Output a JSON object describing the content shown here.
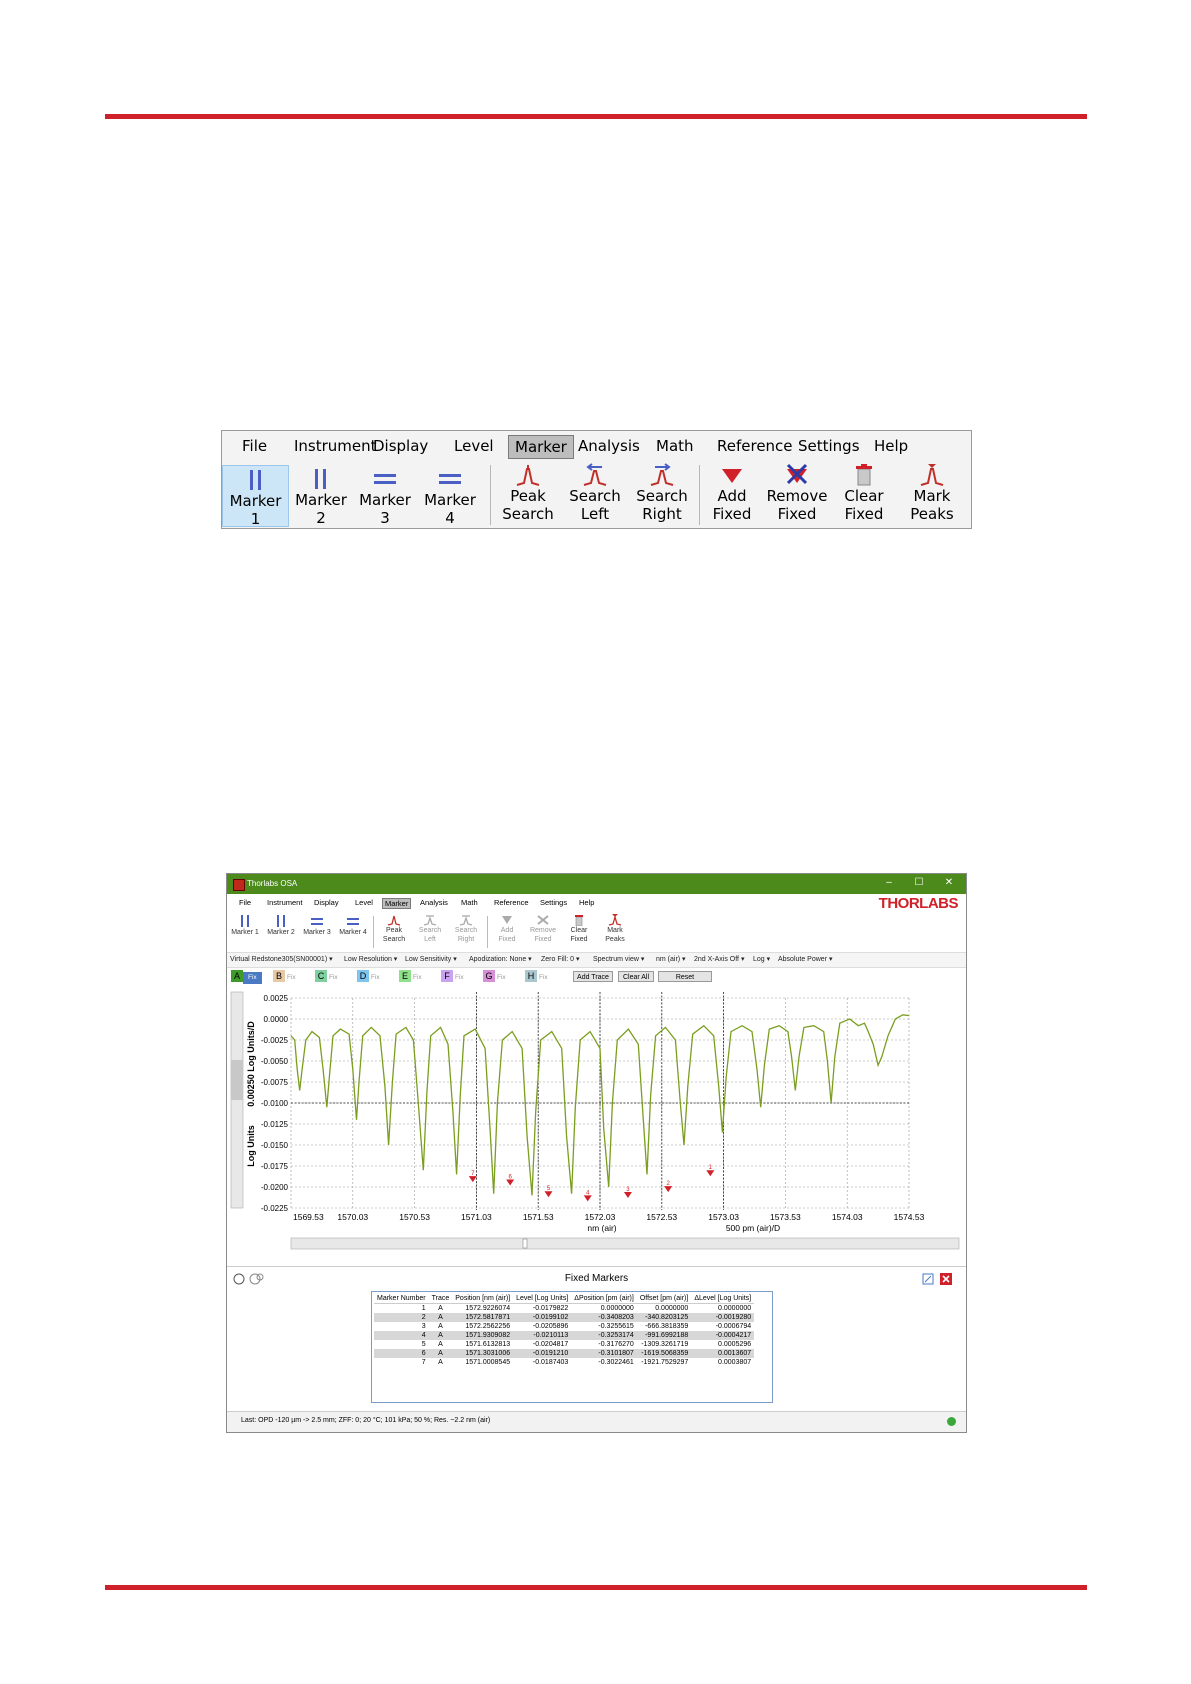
{
  "ribbon": {
    "menu": [
      "File",
      "Instrument",
      "Display",
      "Level",
      "Marker",
      "Analysis",
      "Math",
      "Reference",
      "Settings",
      "Help"
    ],
    "active_menu": "Marker",
    "buttons": [
      {
        "label1": "Marker 1",
        "label2": "",
        "icon": "marker-bars-icon"
      },
      {
        "label1": "Marker 2",
        "label2": "",
        "icon": "marker-bars-icon"
      },
      {
        "label1": "Marker 3",
        "label2": "",
        "icon": "marker-lines-icon"
      },
      {
        "label1": "Marker 4",
        "label2": "",
        "icon": "marker-lines-icon"
      },
      {
        "label1": "Peak",
        "label2": "Search",
        "icon": "peak-search-icon"
      },
      {
        "label1": "Search",
        "label2": "Left",
        "icon": "search-left-icon"
      },
      {
        "label1": "Search",
        "label2": "Right",
        "icon": "search-right-icon"
      },
      {
        "label1": "Add",
        "label2": "Fixed",
        "icon": "add-fixed-icon"
      },
      {
        "label1": "Remove",
        "label2": "Fixed",
        "icon": "remove-fixed-icon"
      },
      {
        "label1": "Clear",
        "label2": "Fixed",
        "icon": "clear-fixed-icon"
      },
      {
        "label1": "Mark",
        "label2": "Peaks",
        "icon": "mark-peaks-icon"
      }
    ]
  },
  "app": {
    "title": "Thorlabs OSA",
    "window_controls": [
      "–",
      "☐",
      "✕"
    ],
    "logo": "THORLABS",
    "menu": [
      "File",
      "Instrument",
      "Display",
      "Level",
      "Marker",
      "Analysis",
      "Math",
      "Reference",
      "Settings",
      "Help"
    ],
    "small_buttons": [
      {
        "l1": "Marker 1",
        "l2": ""
      },
      {
        "l1": "Marker 2",
        "l2": ""
      },
      {
        "l1": "Marker 3",
        "l2": ""
      },
      {
        "l1": "Marker 4",
        "l2": ""
      },
      {
        "l1": "Peak",
        "l2": "Search"
      },
      {
        "l1": "Search",
        "l2": "Left"
      },
      {
        "l1": "Search",
        "l2": "Right"
      },
      {
        "l1": "Add",
        "l2": "Fixed"
      },
      {
        "l1": "Remove",
        "l2": "Fixed"
      },
      {
        "l1": "Clear",
        "l2": "Fixed"
      },
      {
        "l1": "Mark",
        "l2": "Peaks"
      }
    ],
    "options": [
      "Virtual Redstone305(SN00001) ▾",
      "Low Resolution ▾",
      "Low Sensitivity ▾",
      "Apodization: None ▾",
      "Zero Fill: 0 ▾",
      "Spectrum view ▾",
      "nm (air) ▾",
      "2nd X-Axis Off ▾",
      "Log ▾",
      "Absolute Power ▾"
    ],
    "traces": [
      {
        "letter": "A",
        "fix": "Fix",
        "color": "#3f9a2a"
      },
      {
        "letter": "B",
        "fix": "Fix",
        "color": "#e7c9a6"
      },
      {
        "letter": "C",
        "fix": "Fix",
        "color": "#7fd0a0"
      },
      {
        "letter": "D",
        "fix": "Fix",
        "color": "#7ec4ef"
      },
      {
        "letter": "E",
        "fix": "Fix",
        "color": "#8ee08a"
      },
      {
        "letter": "F",
        "fix": "Fix",
        "color": "#c9a3ef"
      },
      {
        "letter": "G",
        "fix": "Fix",
        "color": "#d78fd6"
      },
      {
        "letter": "H",
        "fix": "Fix",
        "color": "#aac7cf"
      }
    ],
    "trace_buttons": [
      "Add Trace",
      "Clear All",
      "Reset"
    ],
    "fixed_markers_title": "Fixed Markers",
    "status": "Last: OPD -120 µm -> 2.5 mm; ZFF: 0; 20 °C; 101 kPa; 50 %; Res. ~2.2 nm (air)"
  },
  "chart_data": {
    "type": "line",
    "ylabel_top": "0.00250 Log Units/D",
    "ylabel_bottom": "Log Units",
    "xlabel": "nm (air)",
    "xlabel_right": "500 pm (air)/D",
    "x_ticks": [
      "1569.53",
      "1570.03",
      "1570.53",
      "1571.03",
      "1571.53",
      "1572.03",
      "1572.53",
      "1573.03",
      "1573.53",
      "1574.03",
      "1574.53"
    ],
    "y_ticks": [
      "0.0025",
      "0.0000",
      "-0.0025",
      "-0.0050",
      "-0.0075",
      "-0.0100",
      "-0.0125",
      "-0.0150",
      "-0.0175",
      "-0.0200",
      "-0.0225"
    ],
    "xlim": [
      1569.53,
      1574.53
    ],
    "ylim": [
      -0.0225,
      0.0025
    ],
    "series": [
      {
        "color": "#7a9e1e",
        "points": [
          [
            1569.53,
            -0.002
          ],
          [
            1569.56,
            -0.0025
          ],
          [
            1569.58,
            -0.006
          ],
          [
            1569.6,
            -0.0085
          ],
          [
            1569.62,
            -0.006
          ],
          [
            1569.65,
            -0.0025
          ],
          [
            1569.7,
            -0.0015
          ],
          [
            1569.76,
            -0.0022
          ],
          [
            1569.79,
            -0.006
          ],
          [
            1569.82,
            -0.0105
          ],
          [
            1569.84,
            -0.007
          ],
          [
            1569.87,
            -0.002
          ],
          [
            1569.93,
            -0.0012
          ],
          [
            1570.0,
            -0.0018
          ],
          [
            1570.03,
            -0.006
          ],
          [
            1570.06,
            -0.012
          ],
          [
            1570.08,
            -0.0075
          ],
          [
            1570.11,
            -0.002
          ],
          [
            1570.18,
            -0.001
          ],
          [
            1570.25,
            -0.002
          ],
          [
            1570.29,
            -0.008
          ],
          [
            1570.32,
            -0.015
          ],
          [
            1570.35,
            -0.0075
          ],
          [
            1570.38,
            -0.0018
          ],
          [
            1570.46,
            -0.001
          ],
          [
            1570.52,
            -0.0025
          ],
          [
            1570.56,
            -0.01
          ],
          [
            1570.6,
            -0.018
          ],
          [
            1570.63,
            -0.0085
          ],
          [
            1570.66,
            -0.002
          ],
          [
            1570.74,
            -0.001
          ],
          [
            1570.8,
            -0.003
          ],
          [
            1570.84,
            -0.011
          ],
          [
            1570.87,
            -0.0185
          ],
          [
            1570.9,
            -0.009
          ],
          [
            1570.93,
            -0.002
          ],
          [
            1571.02,
            -0.0012
          ],
          [
            1571.1,
            -0.0035
          ],
          [
            1571.14,
            -0.013
          ],
          [
            1571.17,
            -0.0208
          ],
          [
            1571.2,
            -0.01
          ],
          [
            1571.24,
            -0.0025
          ],
          [
            1571.32,
            -0.0015
          ],
          [
            1571.4,
            -0.0035
          ],
          [
            1571.44,
            -0.014
          ],
          [
            1571.48,
            -0.021
          ],
          [
            1571.51,
            -0.011
          ],
          [
            1571.55,
            -0.0025
          ],
          [
            1571.64,
            -0.0015
          ],
          [
            1571.72,
            -0.0035
          ],
          [
            1571.76,
            -0.014
          ],
          [
            1571.8,
            -0.0208
          ],
          [
            1571.83,
            -0.0105
          ],
          [
            1571.87,
            -0.0025
          ],
          [
            1571.95,
            -0.0015
          ],
          [
            1572.03,
            -0.0035
          ],
          [
            1572.06,
            -0.013
          ],
          [
            1572.1,
            -0.02
          ],
          [
            1572.13,
            -0.01
          ],
          [
            1572.17,
            -0.0025
          ],
          [
            1572.26,
            -0.0012
          ],
          [
            1572.34,
            -0.003
          ],
          [
            1572.38,
            -0.012
          ],
          [
            1572.41,
            -0.0185
          ],
          [
            1572.44,
            -0.009
          ],
          [
            1572.48,
            -0.002
          ],
          [
            1572.56,
            -0.001
          ],
          [
            1572.64,
            -0.0025
          ],
          [
            1572.68,
            -0.01
          ],
          [
            1572.71,
            -0.015
          ],
          [
            1572.74,
            -0.008
          ],
          [
            1572.78,
            -0.0018
          ],
          [
            1572.87,
            -0.0008
          ],
          [
            1572.95,
            -0.002
          ],
          [
            1572.99,
            -0.008
          ],
          [
            1573.02,
            -0.0135
          ],
          [
            1573.05,
            -0.007
          ],
          [
            1573.09,
            -0.0015
          ],
          [
            1573.18,
            -0.0008
          ],
          [
            1573.26,
            -0.0015
          ],
          [
            1573.3,
            -0.006
          ],
          [
            1573.33,
            -0.0105
          ],
          [
            1573.36,
            -0.0055
          ],
          [
            1573.4,
            -0.0012
          ],
          [
            1573.48,
            -0.0008
          ],
          [
            1573.55,
            -0.0015
          ],
          [
            1573.58,
            -0.0045
          ],
          [
            1573.61,
            -0.0085
          ],
          [
            1573.64,
            -0.0045
          ],
          [
            1573.68,
            -0.001
          ],
          [
            1573.76,
            -0.0008
          ],
          [
            1573.84,
            -0.0015
          ],
          [
            1573.87,
            -0.005
          ],
          [
            1573.9,
            -0.01
          ],
          [
            1573.93,
            -0.0045
          ],
          [
            1573.97,
            -0.0005
          ],
          [
            1574.05,
            0.0
          ],
          [
            1574.12,
            -0.0008
          ],
          [
            1574.17,
            -0.0005
          ],
          [
            1574.2,
            -0.0015
          ],
          [
            1574.24,
            -0.003
          ],
          [
            1574.28,
            -0.0055
          ],
          [
            1574.31,
            -0.0045
          ],
          [
            1574.36,
            -0.002
          ],
          [
            1574.42,
            0.0
          ],
          [
            1574.48,
            0.0005
          ],
          [
            1574.53,
            0.0004
          ]
        ]
      }
    ],
    "marker_lines": [
      1571.03,
      1571.53,
      1572.03,
      1572.53,
      1573.03
    ],
    "fixed_markers": [
      {
        "x": 1571.0009,
        "y": -0.0187,
        "label": "7"
      },
      {
        "x": 1571.3031,
        "y": -0.0191,
        "label": "6"
      },
      {
        "x": 1571.6133,
        "y": -0.0205,
        "label": "5"
      },
      {
        "x": 1571.9309,
        "y": -0.021,
        "label": "4"
      },
      {
        "x": 1572.2562,
        "y": -0.0206,
        "label": "3"
      },
      {
        "x": 1572.5818,
        "y": -0.0199,
        "label": "2"
      },
      {
        "x": 1572.9226,
        "y": -0.018,
        "label": "1"
      }
    ],
    "table": {
      "headers": [
        "Marker Number",
        "Trace",
        "Position [nm (air)]",
        "Level [Log Units]",
        "ΔPosition [pm (air)]",
        "Offset [pm (air)]",
        "ΔLevel [Log Units]"
      ],
      "rows": [
        [
          "1",
          "A",
          "1572.9226074",
          "-0.0179822",
          "0.0000000",
          "0.0000000",
          "0.0000000"
        ],
        [
          "2",
          "A",
          "1572.5817871",
          "-0.0199102",
          "-0.3408203",
          "-340.8203125",
          "-0.0019280"
        ],
        [
          "3",
          "A",
          "1572.2562256",
          "-0.0205896",
          "-0.3255615",
          "-666.3818359",
          "-0.0006794"
        ],
        [
          "4",
          "A",
          "1571.9309082",
          "-0.0210113",
          "-0.3253174",
          "-991.6992188",
          "-0.0004217"
        ],
        [
          "5",
          "A",
          "1571.6132813",
          "-0.0204817",
          "-0.3176270",
          "-1309.3261719",
          "0.0005296"
        ],
        [
          "6",
          "A",
          "1571.3031006",
          "-0.0191210",
          "-0.3101807",
          "-1619.5068359",
          "0.0013607"
        ],
        [
          "7",
          "A",
          "1571.0008545",
          "-0.0187403",
          "-0.3022461",
          "-1921.7529297",
          "0.0003807"
        ]
      ]
    }
  }
}
